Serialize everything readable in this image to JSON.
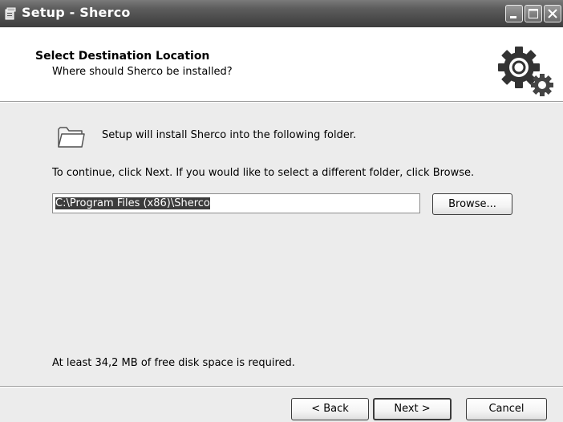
{
  "window": {
    "title": "Setup - Sherco",
    "app_icon": "installer-icon",
    "controls": {
      "minimize_icon": "minimize-icon",
      "maximize_icon": "maximize-icon",
      "close_icon": "close-icon"
    }
  },
  "header": {
    "title": "Select Destination Location",
    "subtitle": "Where should Sherco be installed?",
    "icon": "gear-icon"
  },
  "body": {
    "folder_icon": "folder-icon",
    "folder_message": "Setup will install Sherco into the following folder.",
    "continue_message": "To continue, click Next. If you would like to select a different folder, click Browse.",
    "path_value": "C:\\Program Files (x86)\\Sherco",
    "browse_label": "Browse...",
    "space_message": "At least 34,2 MB of free disk space is required."
  },
  "footer": {
    "back_label": "< Back",
    "next_label": "Next >",
    "cancel_label": "Cancel"
  },
  "colors": {
    "titlebar": "#4a4a4a",
    "dialog_background": "#ececec",
    "header_background": "#ffffff",
    "selection": "#3c3c3c"
  }
}
